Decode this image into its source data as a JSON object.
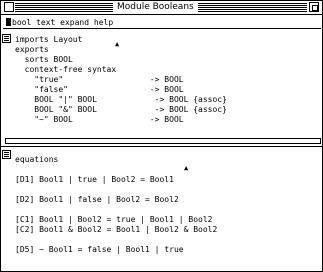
{
  "window": {
    "title": "Module Booleans"
  },
  "input": {
    "text": "bool text expand help"
  },
  "signature": {
    "lines": [
      "imports Layout",
      "exports",
      "  sorts BOOL",
      "  context-free syntax",
      "    \"true\"                  -> BOOL",
      "    \"false\"                 -> BOOL",
      "    BOOL \"|\" BOOL            -> BOOL {assoc}",
      "    BOOL \"&\" BOOL            -> BOOL {assoc}",
      "    \"~\" BOOL                -> BOOL"
    ]
  },
  "equations": {
    "header": "equations",
    "blocks": [
      [
        "[D1] Bool1 | true | Bool2 = Bool1"
      ],
      [
        "[D2] Bool1 | false | Bool2 = Bool2"
      ],
      [
        "[C1] Bool1 | Bool2 = true | Bool1 | Bool2",
        "[C2] Bool1 & Bool2 = Bool1 | Bool2 & Bool2"
      ],
      [
        "[D5] ~ Bool1 = false | Bool1 | true"
      ]
    ]
  },
  "icons": {
    "close": "close-box-icon",
    "zoom": "zoom-box-icon",
    "pane": "pane-menu-icon",
    "mouse": "mouse-pointer-icon"
  }
}
